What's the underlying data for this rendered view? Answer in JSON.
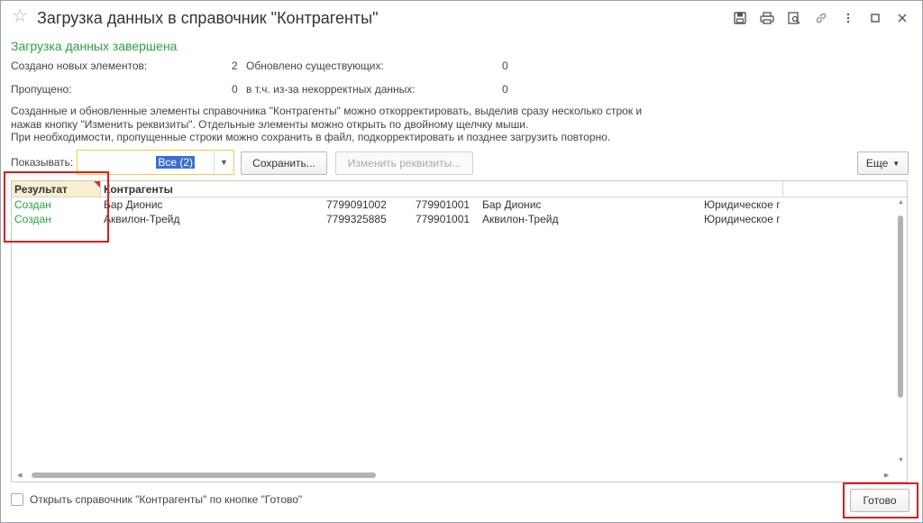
{
  "window": {
    "title": "Загрузка данных в справочник \"Контрагенты\"",
    "icons": [
      "star-icon",
      "save-icon",
      "print-icon",
      "preview-icon",
      "link-icon",
      "more-icon",
      "maximize-icon",
      "close-icon"
    ]
  },
  "status": "Загрузка данных завершена",
  "stats": {
    "created_label": "Создано новых элементов:",
    "created_value": "2",
    "updated_label": "Обновлено существующих:",
    "updated_value": "0",
    "skipped_label": "Пропущено:",
    "skipped_value": "0",
    "invalid_label": "в т.ч. из-за некорректных данных:",
    "invalid_value": "0"
  },
  "info": {
    "line1": "Созданные и обновленные элементы справочника \"Контрагенты\" можно откорректировать, выделив сразу несколько строк и",
    "line2": "нажав кнопку \"Изменить реквизиты\". Отдельные элементы можно открыть по двойному щелчку мыши.",
    "line3": "При необходимости, пропущенные строки можно сохранить в файл, подкорректировать и позднее загрузить повторно."
  },
  "toolbar": {
    "show_label": "Показывать:",
    "filter_value": "Все (2)",
    "save_label": "Сохранить...",
    "change_label": "Изменить реквизиты...",
    "more_label": "Еще"
  },
  "table": {
    "headers": [
      "Результат",
      "Контрагенты"
    ],
    "rows": [
      {
        "result": "Создан",
        "name": "Бар Дионис",
        "inn": "7799091002",
        "kpp": "779901001",
        "full_name": "Бар Дионис",
        "type": "Юридическое г"
      },
      {
        "result": "Создан",
        "name": "Аквилон-Трейд",
        "inn": "7799325885",
        "kpp": "779901001",
        "full_name": "Аквилон-Трейд",
        "type": "Юридическое г"
      }
    ]
  },
  "footer": {
    "checkbox_label": "Открыть справочник \"Контрагенты\" по кнопке \"Готово\"",
    "done_label": "Готово"
  },
  "colors": {
    "accent_green": "#2aa145",
    "highlight_red": "#e21b1b",
    "selection_blue": "#3a6ed0",
    "focus_yellow": "#f2c94c"
  }
}
